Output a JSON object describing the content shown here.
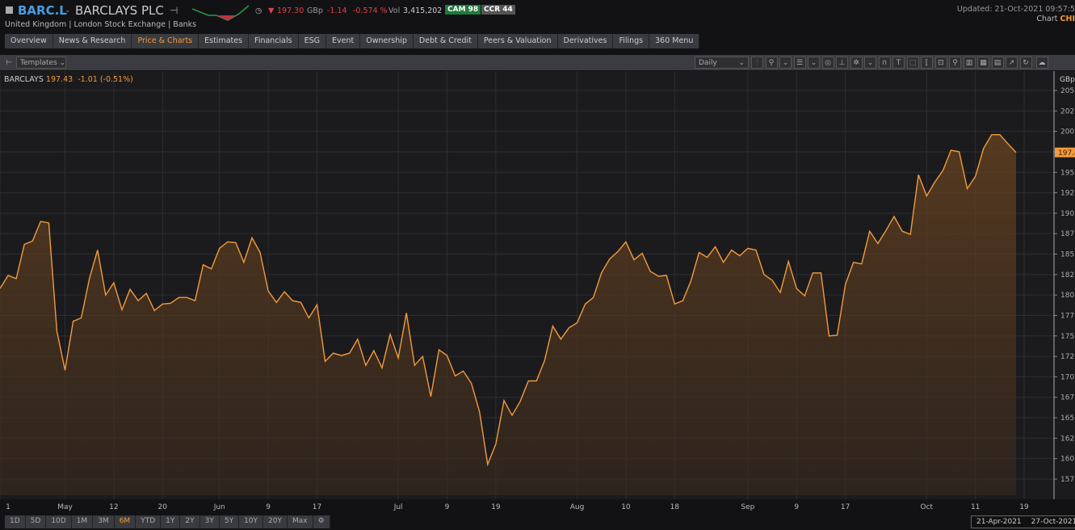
{
  "header": {
    "ric": "BARC.L",
    "name": "BARCLAYS PLC",
    "subtitle": "United Kingdom | London Stock Exchange | Banks",
    "price": "197.30",
    "currency": "GBp",
    "change": "-1.14",
    "change_pct": "-0.574 %",
    "vol_label": "Vol",
    "volume": "3,415,202",
    "cam": "CAM 98",
    "ccr": "CCR 44",
    "updated": "Updated: 21-Oct-2021 09:57:5",
    "chart_label": "Chart",
    "chart_code": "CHI"
  },
  "tabs": [
    "Overview",
    "News & Research",
    "Price & Charts",
    "Estimates",
    "Financials",
    "ESG",
    "Event",
    "Ownership",
    "Debt & Credit",
    "Peers & Valuation",
    "Derivatives",
    "Filings",
    "360 Menu"
  ],
  "active_tab": "Price & Charts",
  "toolbar": {
    "templates": "Templates",
    "interval": "Daily"
  },
  "legend": {
    "name": "BARCLAYS",
    "last": "197.43",
    "chg": "-1.01 (-0.51%)"
  },
  "ranges": [
    "1D",
    "5D",
    "10D",
    "1M",
    "3M",
    "6M",
    "YTD",
    "1Y",
    "2Y",
    "3Y",
    "5Y",
    "10Y",
    "20Y",
    "Max"
  ],
  "active_range": "6M",
  "date_range": {
    "start": "21-Apr-2021",
    "end": "27-Oct-2021"
  },
  "colors": {
    "line": "#f39a3a",
    "accent": "#f39a3a",
    "ric": "#4a9de0",
    "down": "#e0404a",
    "cam": "#1e7a3c"
  },
  "chart_data": {
    "type": "area",
    "unit": "GBp",
    "last_value": "197.4",
    "ylim": [
      157.5,
      205
    ],
    "yticks": [
      "205.0",
      "202.5",
      "200.0",
      "197.5",
      "195.0",
      "192.5",
      "190.0",
      "187.5",
      "185.0",
      "182.5",
      "180.0",
      "177.5",
      "175.0",
      "172.5",
      "170.0",
      "167.5",
      "165.0",
      "162.5",
      "160.0",
      "157.5"
    ],
    "xticks": [
      {
        "label": "1",
        "i": 0
      },
      {
        "label": "May",
        "i": 8
      },
      {
        "label": "12",
        "i": 14
      },
      {
        "label": "20",
        "i": 20
      },
      {
        "label": "Jun",
        "i": 27
      },
      {
        "label": "9",
        "i": 33
      },
      {
        "label": "17",
        "i": 39
      },
      {
        "label": "Jul",
        "i": 49
      },
      {
        "label": "9",
        "i": 55
      },
      {
        "label": "19",
        "i": 61
      },
      {
        "label": "Aug",
        "i": 71
      },
      {
        "label": "10",
        "i": 77
      },
      {
        "label": "18",
        "i": 83
      },
      {
        "label": "Sep",
        "i": 92
      },
      {
        "label": "9",
        "i": 98
      },
      {
        "label": "17",
        "i": 104
      },
      {
        "label": "Oct",
        "i": 114
      },
      {
        "label": "11",
        "i": 120
      },
      {
        "label": "19",
        "i": 126
      }
    ],
    "values": [
      180.8,
      182.4,
      182.0,
      186.2,
      186.6,
      189.0,
      188.8,
      175.6,
      170.8,
      176.8,
      177.2,
      182.0,
      185.5,
      180.0,
      181.5,
      178.2,
      180.7,
      179.3,
      180.2,
      178.1,
      178.9,
      179.0,
      179.7,
      179.7,
      179.3,
      183.7,
      183.2,
      185.7,
      186.5,
      186.4,
      184.0,
      187.0,
      185.2,
      180.5,
      179.1,
      180.4,
      179.3,
      179.1,
      177.2,
      178.8,
      171.9,
      172.9,
      172.6,
      172.9,
      174.6,
      171.4,
      173.2,
      171.1,
      175.2,
      172.3,
      177.8,
      171.4,
      172.5,
      167.6,
      173.3,
      172.6,
      170.1,
      170.7,
      169.2,
      165.7,
      159.3,
      161.8,
      167.1,
      165.3,
      167.0,
      169.5,
      169.5,
      172.0,
      176.2,
      174.6,
      176.0,
      176.6,
      178.9,
      179.7,
      182.7,
      184.4,
      185.3,
      186.5,
      184.3,
      185.1,
      182.9,
      182.3,
      182.4,
      178.9,
      179.3,
      181.7,
      185.2,
      184.6,
      185.9,
      184.0,
      185.5,
      184.8,
      185.7,
      185.5,
      182.5,
      181.8,
      180.3,
      184.1,
      180.8,
      179.9,
      182.7,
      182.7,
      175.0,
      175.1,
      181.3,
      184.0,
      183.8,
      187.8,
      186.3,
      187.9,
      189.6,
      187.8,
      187.4,
      194.7,
      192.1,
      193.8,
      195.2,
      197.7,
      197.5,
      193.0,
      194.5,
      197.9,
      199.6,
      199.6,
      198.5,
      197.43
    ]
  }
}
